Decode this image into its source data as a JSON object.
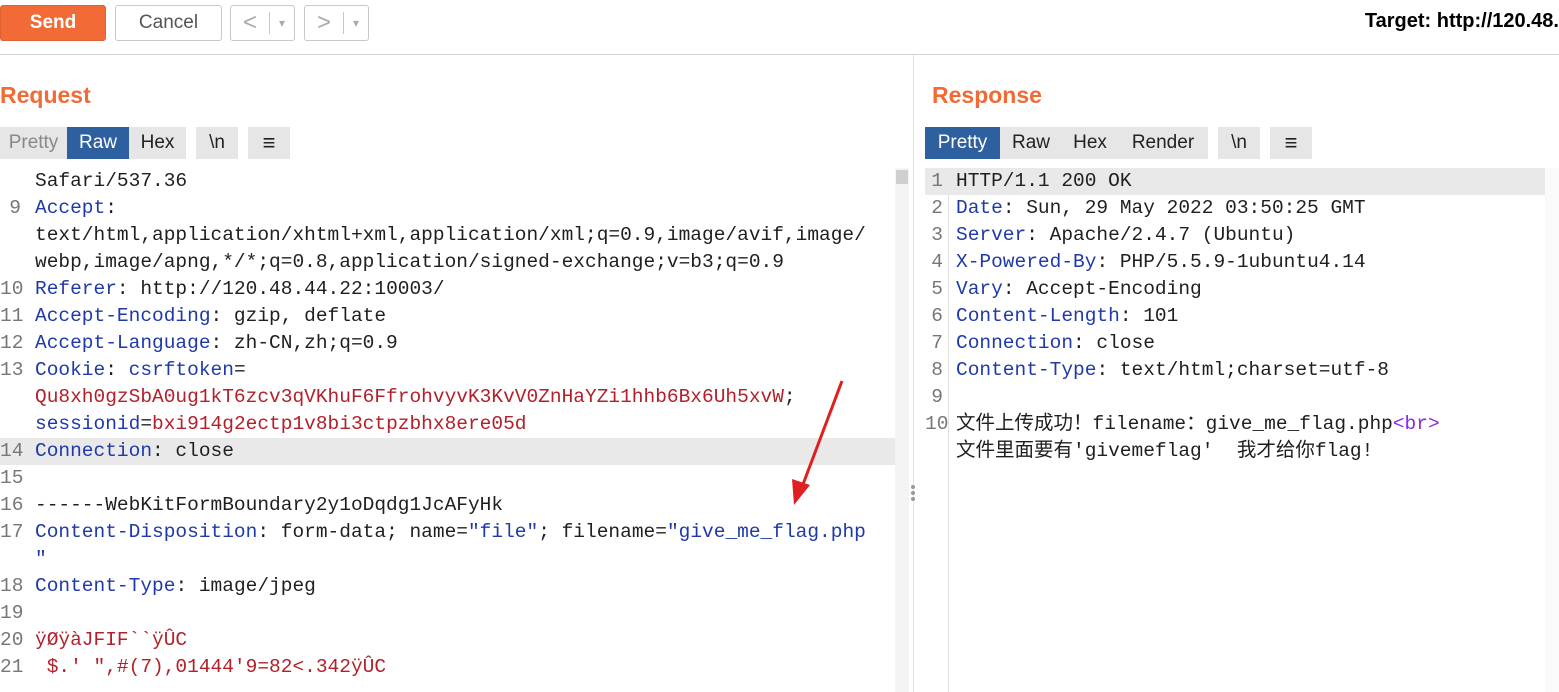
{
  "toolbar": {
    "send_label": "Send",
    "cancel_label": "Cancel",
    "back_arrow": "<",
    "forward_arrow": ">",
    "dropdown_glyph": "▾",
    "target_text": "Target: http://120.48."
  },
  "request": {
    "title": "Request",
    "tabs": [
      "Pretty",
      "Raw",
      "Hex",
      "\\n"
    ],
    "active_tab": "Raw",
    "menu_glyph": "≡",
    "lines": [
      {
        "n": "",
        "parts": [
          {
            "t": "Safari/537.36",
            "c": "hv"
          }
        ]
      },
      {
        "n": "9",
        "parts": [
          {
            "t": "Accept",
            "c": "hk"
          },
          {
            "t": ":",
            "c": "hv"
          }
        ]
      },
      {
        "n": "",
        "parts": [
          {
            "t": "text/html,application/xhtml+xml,application/xml;q=0.9,image/avif,image/",
            "c": "hv"
          }
        ]
      },
      {
        "n": "",
        "parts": [
          {
            "t": "webp,image/apng,*/*;q=0.8,application/signed-exchange;v=b3;q=0.9",
            "c": "hv"
          }
        ]
      },
      {
        "n": "10",
        "parts": [
          {
            "t": "Referer",
            "c": "hk"
          },
          {
            "t": ": http://120.48.44.22:10003/",
            "c": "hv"
          }
        ]
      },
      {
        "n": "11",
        "parts": [
          {
            "t": "Accept-Encoding",
            "c": "hk"
          },
          {
            "t": ": gzip, deflate",
            "c": "hv"
          }
        ]
      },
      {
        "n": "12",
        "parts": [
          {
            "t": "Accept-Language",
            "c": "hk"
          },
          {
            "t": ": zh-CN,zh;q=0.9",
            "c": "hv"
          }
        ]
      },
      {
        "n": "13",
        "parts": [
          {
            "t": "Cookie",
            "c": "hk"
          },
          {
            "t": ": ",
            "c": "hv"
          },
          {
            "t": "csrftoken",
            "c": "ck"
          },
          {
            "t": "=",
            "c": "hv"
          }
        ]
      },
      {
        "n": "",
        "parts": [
          {
            "t": "Qu8xh0gzSbA0ug1kT6zcv3qVKhuF6FfrohvyvK3KvV0ZnHaYZi1hhb6Bx6Uh5xvW",
            "c": "cv"
          },
          {
            "t": ";",
            "c": "hv"
          }
        ]
      },
      {
        "n": "",
        "parts": [
          {
            "t": "sessionid",
            "c": "ck"
          },
          {
            "t": "=",
            "c": "hv"
          },
          {
            "t": "bxi914g2ectp1v8bi3ctpzbhx8ere05d",
            "c": "cv"
          }
        ]
      },
      {
        "n": "14",
        "hl": true,
        "parts": [
          {
            "t": "Connection",
            "c": "hk"
          },
          {
            "t": ": close",
            "c": "hv"
          }
        ]
      },
      {
        "n": "15",
        "parts": []
      },
      {
        "n": "16",
        "parts": [
          {
            "t": "------WebKitFormBoundary2y1oDqdg1JcAFyHk",
            "c": "hv"
          }
        ]
      },
      {
        "n": "17",
        "parts": [
          {
            "t": "Content-Disposition",
            "c": "hk"
          },
          {
            "t": ": form-data; name=",
            "c": "hv"
          },
          {
            "t": "\"file\"",
            "c": "qs"
          },
          {
            "t": "; filename=",
            "c": "hv"
          },
          {
            "t": "\"give_me_flag.php",
            "c": "qs"
          }
        ]
      },
      {
        "n": "",
        "parts": [
          {
            "t": "\"",
            "c": "qs"
          }
        ]
      },
      {
        "n": "18",
        "parts": [
          {
            "t": "Content-Type",
            "c": "hk"
          },
          {
            "t": ": image/jpeg",
            "c": "hv"
          }
        ]
      },
      {
        "n": "19",
        "parts": []
      },
      {
        "n": "20",
        "parts": [
          {
            "t": "ÿØÿàJFIF``ÿÛC",
            "c": "bin"
          }
        ]
      },
      {
        "n": "21",
        "parts": [
          {
            "t": " $.' \",#(7),01444'9=82<.342ÿÛC",
            "c": "bin"
          }
        ]
      }
    ]
  },
  "response": {
    "title": "Response",
    "tabs": [
      "Pretty",
      "Raw",
      "Hex",
      "Render",
      "\\n"
    ],
    "active_tab": "Pretty",
    "menu_glyph": "≡",
    "lines": [
      {
        "n": "1",
        "hl": true,
        "parts": [
          {
            "t": "HTTP/1.1 200 OK",
            "c": "hv"
          }
        ]
      },
      {
        "n": "2",
        "parts": [
          {
            "t": "Date",
            "c": "hk"
          },
          {
            "t": ": Sun, 29 May 2022 03:50:25 GMT",
            "c": "hv"
          }
        ]
      },
      {
        "n": "3",
        "parts": [
          {
            "t": "Server",
            "c": "hk"
          },
          {
            "t": ": Apache/2.4.7 (Ubuntu)",
            "c": "hv"
          }
        ]
      },
      {
        "n": "4",
        "parts": [
          {
            "t": "X-Powered-By",
            "c": "hk"
          },
          {
            "t": ": PHP/5.5.9-1ubuntu4.14",
            "c": "hv"
          }
        ]
      },
      {
        "n": "5",
        "parts": [
          {
            "t": "Vary",
            "c": "hk"
          },
          {
            "t": ": Accept-Encoding",
            "c": "hv"
          }
        ]
      },
      {
        "n": "6",
        "parts": [
          {
            "t": "Content-Length",
            "c": "hk"
          },
          {
            "t": ": 101",
            "c": "hv"
          }
        ]
      },
      {
        "n": "7",
        "parts": [
          {
            "t": "Connection",
            "c": "hk"
          },
          {
            "t": ": close",
            "c": "hv"
          }
        ]
      },
      {
        "n": "8",
        "parts": [
          {
            "t": "Content-Type",
            "c": "hk"
          },
          {
            "t": ": text/html;charset=utf-8",
            "c": "hv"
          }
        ]
      },
      {
        "n": "9",
        "parts": []
      },
      {
        "n": "10",
        "parts": [
          {
            "t": "文件上传成功！filename：give_me_flag.php",
            "c": "hv"
          },
          {
            "t": "<br>",
            "c": "tag"
          }
        ]
      },
      {
        "n": "",
        "parts": [
          {
            "t": "文件里面要有'givemeflag'  我才给你flag!",
            "c": "hv"
          }
        ]
      }
    ]
  },
  "colors": {
    "accent": "#f26a35",
    "active_tab": "#2e5f9e",
    "header_key": "#1f3aa8",
    "cookie_value": "#b3202a",
    "annotation_arrow": "#e02020"
  }
}
